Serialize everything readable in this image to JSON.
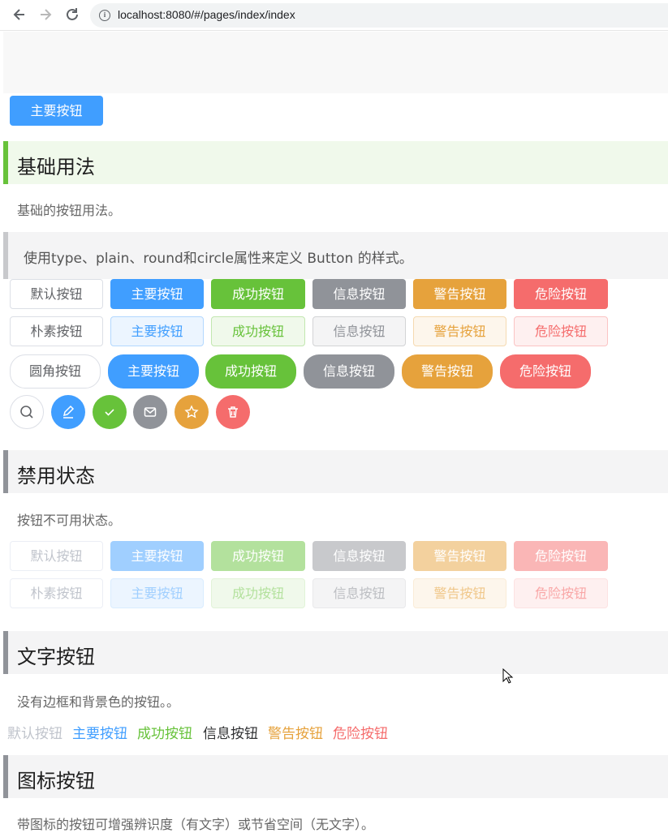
{
  "browser": {
    "url": "localhost:8080/#/pages/index/index",
    "back_icon": "arrow-left-icon",
    "forward_icon": "arrow-right-icon",
    "reload_icon": "reload-icon"
  },
  "top_button": {
    "label": "主要按钮"
  },
  "basic": {
    "title": "基础用法",
    "desc": "基础的按钮用法。",
    "tip": "使用type、plain、round和circle属性来定义 Button 的样式。",
    "row_default": [
      "默认按钮",
      "主要按钮",
      "成功按钮",
      "信息按钮",
      "警告按钮",
      "危险按钮"
    ],
    "row_plain": [
      "朴素按钮",
      "主要按钮",
      "成功按钮",
      "信息按钮",
      "警告按钮",
      "危险按钮"
    ],
    "row_round": [
      "圆角按钮",
      "主要按钮",
      "成功按钮",
      "信息按钮",
      "警告按钮",
      "危险按钮"
    ],
    "row_circle_icons": [
      "search-icon",
      "edit-icon",
      "check-icon",
      "message-icon",
      "star-icon",
      "delete-icon"
    ]
  },
  "disabled": {
    "title": "禁用状态",
    "desc": "按钮不可用状态。",
    "row_default": [
      "默认按钮",
      "主要按钮",
      "成功按钮",
      "信息按钮",
      "警告按钮",
      "危险按钮"
    ],
    "row_plain": [
      "朴素按钮",
      "主要按钮",
      "成功按钮",
      "信息按钮",
      "警告按钮",
      "危险按钮"
    ]
  },
  "text_buttons": {
    "title": "文字按钮",
    "desc": "没有边框和背景色的按钮。。",
    "items": [
      "默认按钮",
      "主要按钮",
      "成功按钮",
      "信息按钮",
      "警告按钮",
      "危险按钮"
    ]
  },
  "icon_buttons": {
    "title": "图标按钮",
    "desc": "带图标的按钮可增强辨识度（有文字）或节省空间（无文字）。"
  },
  "colors": {
    "primary": "#409eff",
    "success": "#67c23a",
    "info": "#909399",
    "warning": "#e6a23c",
    "danger": "#f56c6c"
  }
}
